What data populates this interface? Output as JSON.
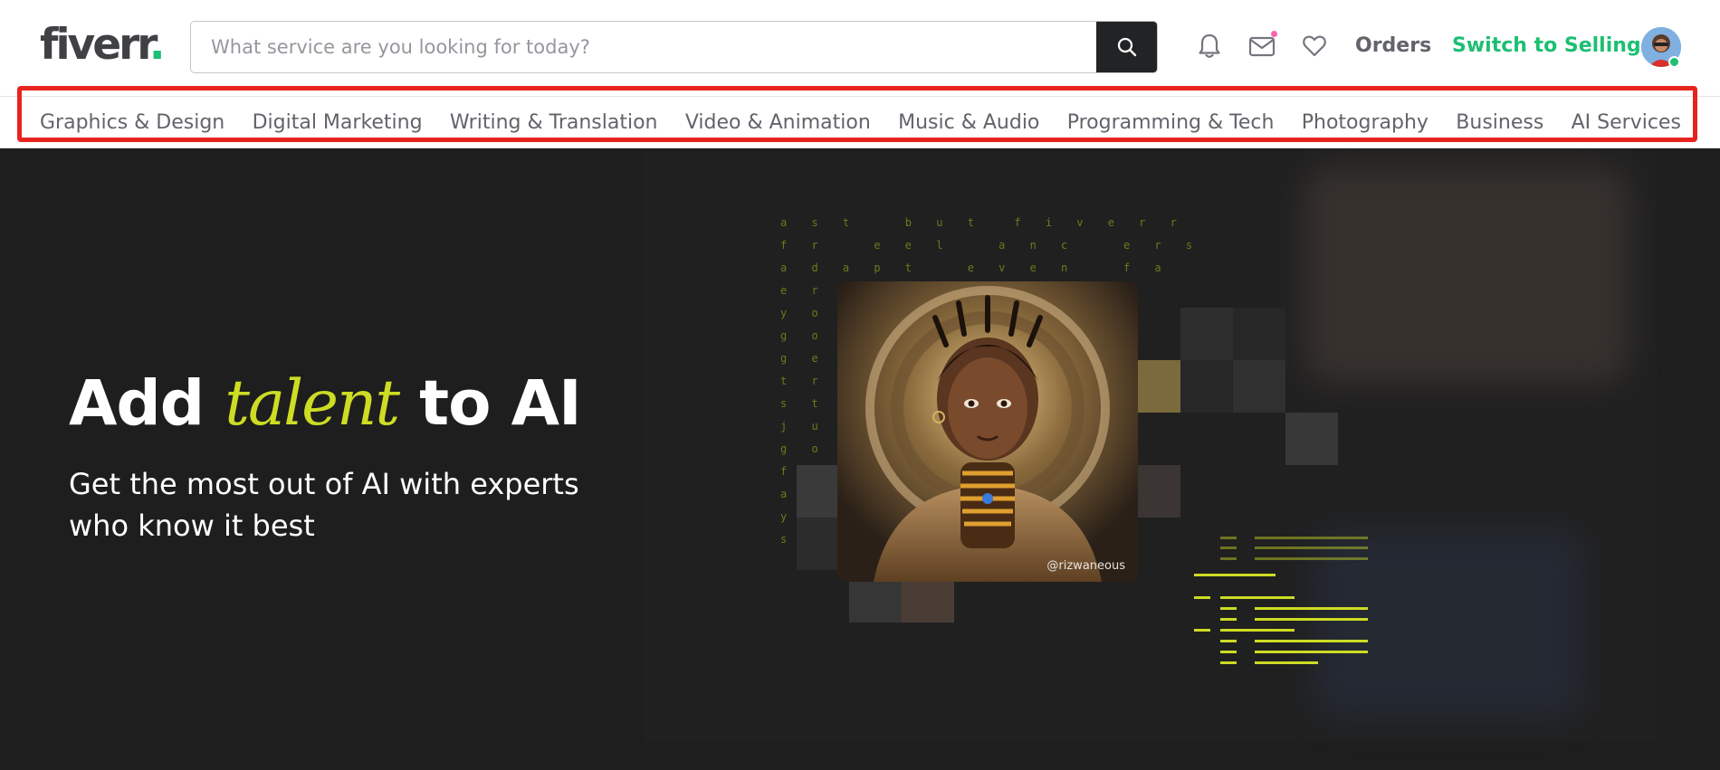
{
  "header": {
    "logo_text": "fiverr",
    "logo_dot": ".",
    "search_placeholder": "What service are you looking for today?",
    "orders_label": "Orders",
    "switch_label": "Switch to Selling"
  },
  "categories": [
    "Graphics & Design",
    "Digital Marketing",
    "Writing & Translation",
    "Video & Animation",
    "Music & Audio",
    "Programming & Tech",
    "Photography",
    "Business",
    "AI Services"
  ],
  "hero": {
    "title_pre": "Add ",
    "title_accent": "talent",
    "title_post": " to AI",
    "subtitle": "Get the most out of AI with experts who know it best",
    "image_credit": "@rizwaneous"
  },
  "colors": {
    "brand_green": "#1dbf73",
    "accent_lime": "#cddc24",
    "highlight_red": "#e8241f",
    "notification_pink": "#ff62ad"
  },
  "icons": [
    "search-icon",
    "bell-icon",
    "mail-icon",
    "heart-icon"
  ]
}
